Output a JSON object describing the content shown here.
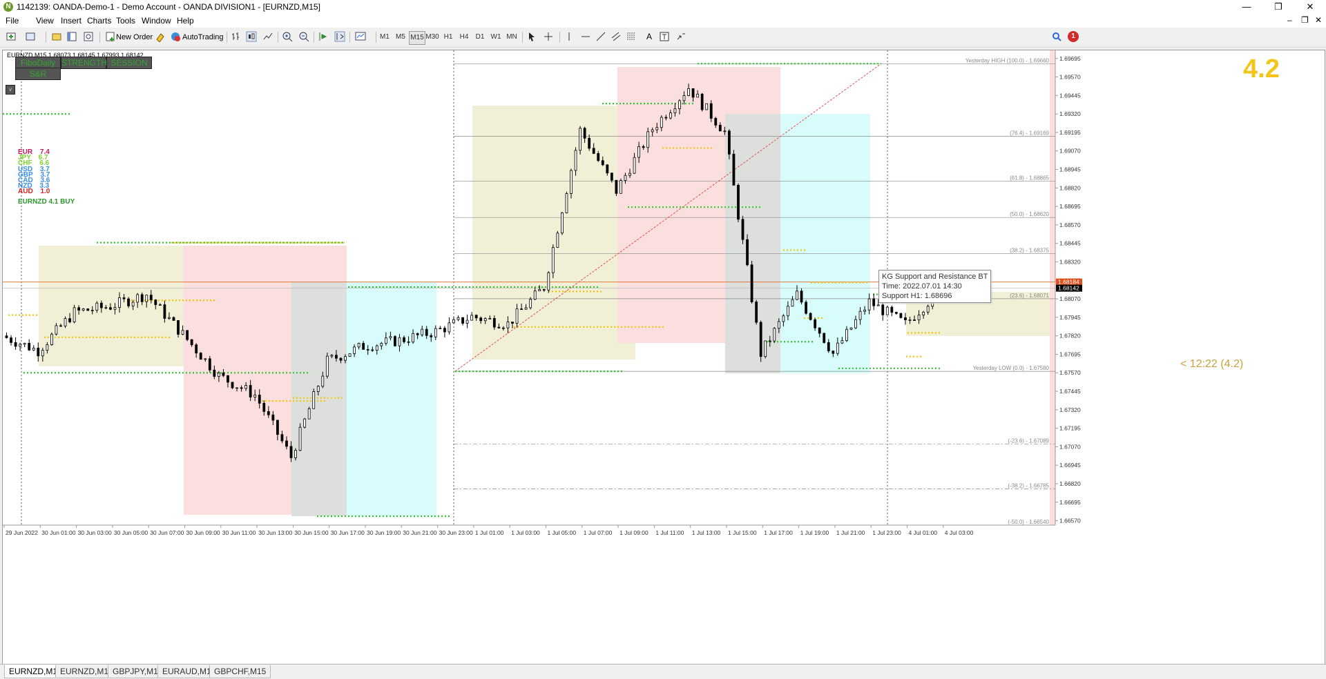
{
  "window": {
    "title": "1142139: OANDA-Demo-1 - Demo Account - OANDA DIVISION1 - [EURNZD,M15]",
    "minimize": "—",
    "restore": "❐",
    "close": "✕"
  },
  "menu": [
    "File",
    "View",
    "Insert",
    "Charts",
    "Tools",
    "Window",
    "Help"
  ],
  "toolbar": {
    "new_order": "New Order",
    "autotrading": "AutoTrading",
    "timeframes": [
      "M1",
      "M5",
      "M15",
      "M30",
      "H1",
      "H4",
      "D1",
      "W1",
      "MN"
    ],
    "active_timeframe": "M15",
    "notification_count": "1"
  },
  "chart": {
    "symbol_header": "EURNZD,M15  1.68073 1.68145 1.67993 1.68142",
    "buttons": {
      "fibo": "FiboDaily",
      "strength": "STRENGTH",
      "session": "SESSION",
      "snr": "S&R",
      "v": "v"
    },
    "strength": [
      {
        "cur": "EUR",
        "val": "7.4",
        "color": "#c2185b"
      },
      {
        "cur": "JPY",
        "val": "6.7",
        "color": "#7cd32f"
      },
      {
        "cur": "CHF",
        "val": "6.6",
        "color": "#7cd32f"
      },
      {
        "cur": "USD",
        "val": "3.7",
        "color": "#3a8ee6"
      },
      {
        "cur": "GBP",
        "val": "3.7",
        "color": "#3a8ee6"
      },
      {
        "cur": "CAD",
        "val": "3.6",
        "color": "#3a8ee6"
      },
      {
        "cur": "NZD",
        "val": "3.3",
        "color": "#3a8ee6"
      },
      {
        "cur": "AUD",
        "val": "1.0",
        "color": "#e02020"
      }
    ],
    "signal": "EURNZD 4.1 BUY",
    "big_value": "4.2",
    "countdown": "< 12:22 (4.2)",
    "tooltip": [
      "KG Support and Resistance BT",
      "Time: 2022.07.01 14:30",
      "Support H1: 1.68696"
    ],
    "fibo_labels": [
      {
        "text": "Yesterday HIGH (100.0) - 1.69660",
        "price": 1.6966
      },
      {
        "text": "(76.4) - 1.69169",
        "price": 1.69169
      },
      {
        "text": "(61.8) - 1.68865",
        "price": 1.68865
      },
      {
        "text": "(50.0) - 1.68620",
        "price": 1.6862
      },
      {
        "text": "(38.2) - 1.68375",
        "price": 1.68375
      },
      {
        "text": "(23.6) - 1.68071",
        "price": 1.68071
      },
      {
        "text": "Yesterday LOW (0.0) - 1.67580",
        "price": 1.6758
      },
      {
        "text": "(-23.6) - 1.67089",
        "price": 1.67089
      },
      {
        "text": "(-38.2) - 1.66785",
        "price": 1.66785
      },
      {
        "text": "(-50.0) - 1.66540",
        "price": 1.6654
      }
    ],
    "price_axis": [
      "1.69695",
      "1.69570",
      "1.69445",
      "1.69320",
      "1.69195",
      "1.69070",
      "1.68945",
      "1.68820",
      "1.68695",
      "1.68570",
      "1.68445",
      "1.68320",
      "1.68195",
      "1.68070",
      "1.67945",
      "1.67820",
      "1.67695",
      "1.67570",
      "1.67445",
      "1.67320",
      "1.67195",
      "1.67070",
      "1.66945",
      "1.66820",
      "1.66695",
      "1.66570"
    ],
    "price_tags": [
      "1.68184",
      "1.68142"
    ],
    "time_axis": [
      "29 Jun 2022",
      "30 Jun 01:00",
      "30 Jun 03:00",
      "30 Jun 05:00",
      "30 Jun 07:00",
      "30 Jun 09:00",
      "30 Jun 11:00",
      "30 Jun 13:00",
      "30 Jun 15:00",
      "30 Jun 17:00",
      "30 Jun 19:00",
      "30 Jun 21:00",
      "30 Jun 23:00",
      "1 Jul 01:00",
      "1 Jul 03:00",
      "1 Jul 05:00",
      "1 Jul 07:00",
      "1 Jul 09:00",
      "1 Jul 11:00",
      "1 Jul 13:00",
      "1 Jul 15:00",
      "1 Jul 17:00",
      "1 Jul 19:00",
      "1 Jul 21:00",
      "1 Jul 23:00",
      "4 Jul 01:00",
      "4 Jul 03:00"
    ]
  },
  "tabs": [
    "EURNZD,M15",
    "EURNZD,M15",
    "GBPJPY,M15",
    "EURAUD,M15",
    "GBPCHF,M15"
  ],
  "chart_data": {
    "type": "candlestick",
    "symbol": "EURNZD",
    "timeframe": "M15",
    "ylim": [
      1.6654,
      1.6975
    ],
    "x": [
      "29 Jun 2022",
      "30 Jun 01:00",
      "30 Jun 03:00",
      "30 Jun 05:00",
      "30 Jun 07:00",
      "30 Jun 09:00",
      "30 Jun 11:00",
      "30 Jun 13:00",
      "30 Jun 15:00",
      "30 Jun 17:00",
      "30 Jun 19:00",
      "30 Jun 21:00",
      "30 Jun 23:00",
      "1 Jul 01:00",
      "1 Jul 03:00",
      "1 Jul 05:00",
      "1 Jul 07:00",
      "1 Jul 09:00",
      "1 Jul 11:00",
      "1 Jul 13:00",
      "1 Jul 15:00",
      "1 Jul 17:00",
      "1 Jul 19:00",
      "1 Jul 21:00",
      "1 Jul 23:00",
      "4 Jul 01:00",
      "4 Jul 03:00"
    ],
    "close": [
      1.6782,
      1.6772,
      1.6798,
      1.6802,
      1.681,
      1.6783,
      1.6755,
      1.6742,
      1.67,
      1.6765,
      1.6775,
      1.6779,
      1.6785,
      1.6795,
      1.679,
      1.6815,
      1.6921,
      1.688,
      1.6922,
      1.695,
      1.692,
      1.677,
      1.681,
      1.677,
      1.6805,
      1.679,
      1.6814
    ],
    "last": {
      "open": 1.68073,
      "high": 1.68145,
      "low": 1.67993,
      "close": 1.68142
    }
  }
}
